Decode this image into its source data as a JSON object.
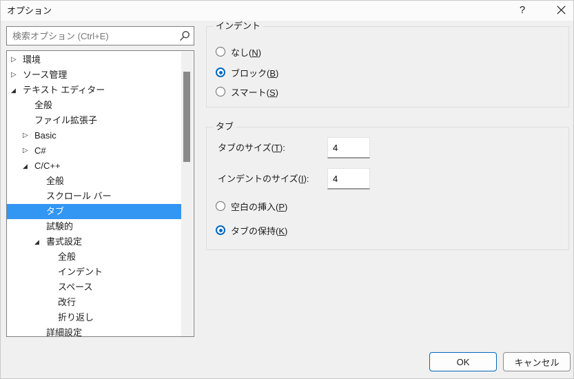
{
  "window": {
    "title": "オプション",
    "help_label": "?"
  },
  "search": {
    "placeholder": "検索オプション (Ctrl+E)"
  },
  "tree": {
    "glyphs": {
      "collapsed": "▷",
      "expanded": "◢"
    },
    "items": [
      {
        "label": "環境",
        "level": 0,
        "state": "collapsed",
        "selected": false
      },
      {
        "label": "ソース管理",
        "level": 0,
        "state": "collapsed",
        "selected": false
      },
      {
        "label": "テキスト エディター",
        "level": 0,
        "state": "expanded",
        "selected": false
      },
      {
        "label": "全般",
        "level": 1,
        "state": "none",
        "selected": false
      },
      {
        "label": "ファイル拡張子",
        "level": 1,
        "state": "none",
        "selected": false
      },
      {
        "label": "Basic",
        "level": 1,
        "state": "collapsed",
        "selected": false
      },
      {
        "label": "C#",
        "level": 1,
        "state": "collapsed",
        "selected": false
      },
      {
        "label": "C/C++",
        "level": 1,
        "state": "expanded",
        "selected": false
      },
      {
        "label": "全般",
        "level": 2,
        "state": "none",
        "selected": false
      },
      {
        "label": "スクロール バー",
        "level": 2,
        "state": "none",
        "selected": false
      },
      {
        "label": "タブ",
        "level": 2,
        "state": "none",
        "selected": true
      },
      {
        "label": "試験的",
        "level": 2,
        "state": "none",
        "selected": false
      },
      {
        "label": "書式設定",
        "level": 2,
        "state": "expanded",
        "selected": false
      },
      {
        "label": "全般",
        "level": 3,
        "state": "none",
        "selected": false
      },
      {
        "label": "インデント",
        "level": 3,
        "state": "none",
        "selected": false
      },
      {
        "label": "スペース",
        "level": 3,
        "state": "none",
        "selected": false
      },
      {
        "label": "改行",
        "level": 3,
        "state": "none",
        "selected": false
      },
      {
        "label": "折り返し",
        "level": 3,
        "state": "none",
        "selected": false
      },
      {
        "label": "詳細設定",
        "level": 2,
        "state": "none",
        "selected": false
      }
    ]
  },
  "indent_group": {
    "title": "インデント",
    "options": [
      {
        "label_prefix": "なし(",
        "access_key": "N",
        "label_suffix": ")",
        "selected": false
      },
      {
        "label_prefix": "ブロック(",
        "access_key": "B",
        "label_suffix": ")",
        "selected": true
      },
      {
        "label_prefix": "スマート(",
        "access_key": "S",
        "label_suffix": ")",
        "selected": false
      }
    ]
  },
  "tab_group": {
    "title": "タブ",
    "fields": [
      {
        "label_prefix": "タブのサイズ(",
        "access_key": "T",
        "label_suffix": "):",
        "value": "4"
      },
      {
        "label_prefix": "インデントのサイズ(",
        "access_key": "I",
        "label_suffix": "):",
        "value": "4"
      }
    ],
    "options": [
      {
        "label_prefix": "空白の挿入(",
        "access_key": "P",
        "label_suffix": ")",
        "selected": false
      },
      {
        "label_prefix": "タブの保持(",
        "access_key": "K",
        "label_suffix": ")",
        "selected": true
      }
    ]
  },
  "buttons": {
    "ok_label": "OK",
    "cancel_label": "キャンセル"
  },
  "colors": {
    "selection_blue": "#3296f3",
    "radio_accent": "#0067c0",
    "ok_border": "#0067c0",
    "body_background": "#f0f0f0",
    "titlebar_background": "#fbfbfb"
  }
}
